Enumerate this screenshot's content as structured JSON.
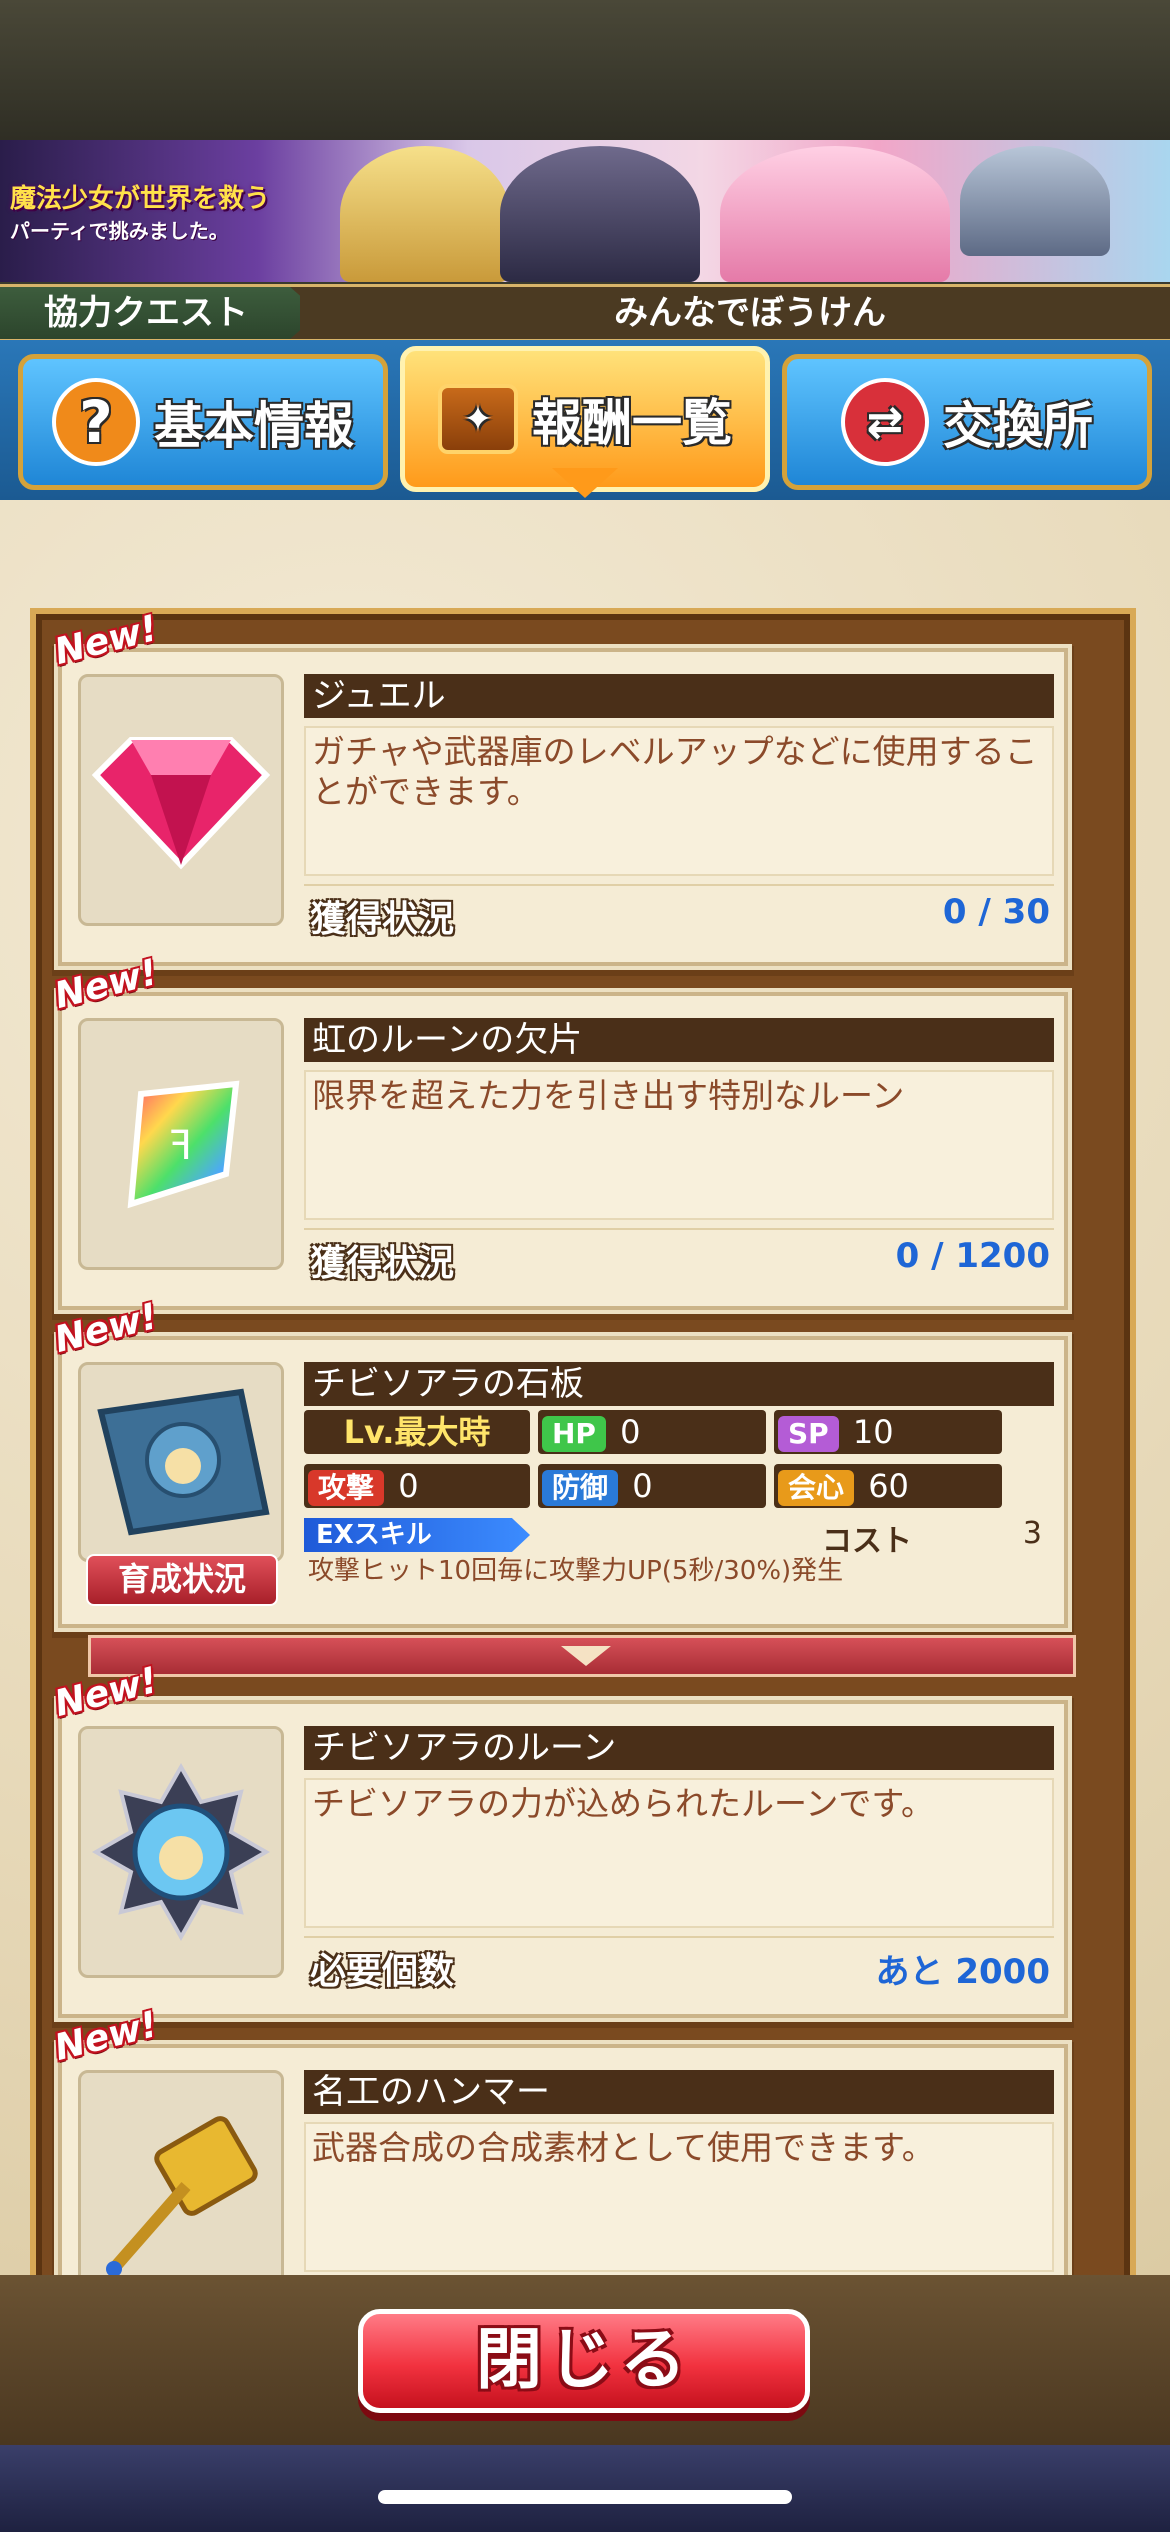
{
  "banner": {
    "line1": "魔法少女が世界を救う",
    "line2": "パーティで挑みました。"
  },
  "quest_header": {
    "category": "協力クエスト",
    "quest_name": "みんなでぼうけん"
  },
  "tabs": [
    {
      "label": "基本情報",
      "icon": "question-icon"
    },
    {
      "label": "報酬一覧",
      "icon": "treasure-chest-icon",
      "active": true
    },
    {
      "label": "交換所",
      "icon": "exchange-bag-icon"
    }
  ],
  "new_label": "New!",
  "rewards": [
    {
      "name": "ジュエル",
      "description": "ガチャや武器庫のレベルアップなどに使用することができます。",
      "status_label": "獲得状況",
      "status_value": "0 / 30",
      "icon": "jewel-icon"
    },
    {
      "name": "虹のルーンの欠片",
      "description": "限界を超えた力を引き出す特別なルーン",
      "status_label": "獲得状況",
      "status_value": "0 / 1200",
      "icon": "rainbow-rune-shard-icon"
    },
    {
      "name": "チビソアラの石板",
      "level_label": "Lv.最大時",
      "stats": {
        "hp_label": "HP",
        "hp": "0",
        "sp_label": "SP",
        "sp": "10",
        "atk_label": "攻撃",
        "atk": "0",
        "def_label": "防御",
        "def": "0",
        "crit_label": "会心",
        "crit": "60"
      },
      "ex_skill_label": "EXスキル",
      "cost_label": "コスト",
      "cost": "3",
      "skill_text": "攻撃ヒット10回毎に攻撃力UP(5秒/30%)発生",
      "growth_button": "育成状況",
      "icon": "stone-tablet-icon"
    },
    {
      "name": "チビソアラのルーン",
      "description": "チビソアラの力が込められたルーンです。",
      "status_label": "必要個数",
      "status_value": "あと 2000",
      "icon": "rune-medallion-icon"
    },
    {
      "name": "名工のハンマー",
      "description": "武器合成の合成素材として使用できます。",
      "icon": "hammer-icon"
    }
  ],
  "close_button": "閉じる",
  "colors": {
    "accent_blue": "#1e66d6",
    "close_red": "#f2323f",
    "frame_brown": "#7a4a1f"
  }
}
